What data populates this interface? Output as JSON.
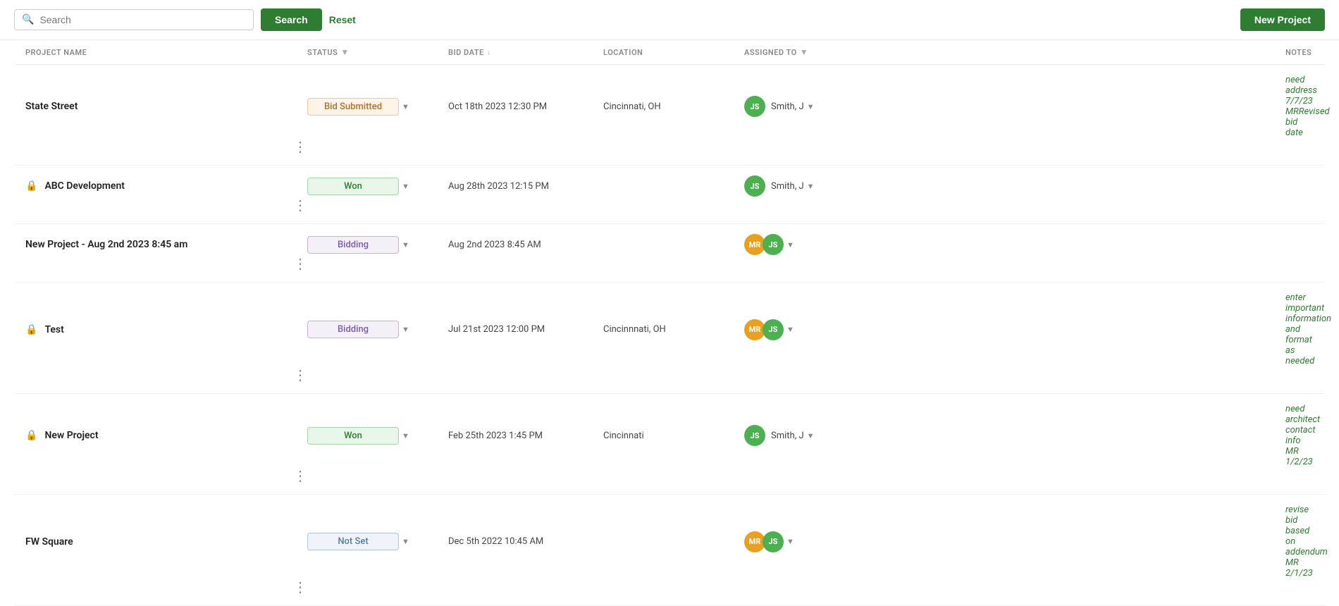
{
  "topbar": {
    "search_placeholder": "Search",
    "search_button": "Search",
    "reset_button": "Reset",
    "new_project_button": "New Project"
  },
  "table": {
    "headers": {
      "project_name": "PROJECT NAME",
      "status": "STATUS",
      "bid_date": "BID DATE",
      "location": "LOCATION",
      "assigned_to": "ASSIGNED TO",
      "notes": "NOTES"
    },
    "rows": [
      {
        "id": 1,
        "name": "State Street",
        "locked": false,
        "status": "Bid Submitted",
        "status_class": "status-bid-submitted",
        "bid_date": "Oct 18th 2023 12:30 PM",
        "location": "Cincinnati, OH",
        "assignees": [
          {
            "initials": "JS",
            "class": "avatar-js"
          }
        ],
        "assigned_name": "Smith, J",
        "notes": "need address 7/7/23 MRRevised bid date"
      },
      {
        "id": 2,
        "name": "ABC Development",
        "locked": true,
        "status": "Won",
        "status_class": "status-won",
        "bid_date": "Aug 28th 2023 12:15 PM",
        "location": "",
        "assignees": [
          {
            "initials": "JS",
            "class": "avatar-js"
          }
        ],
        "assigned_name": "Smith, J",
        "notes": ""
      },
      {
        "id": 3,
        "name": "New Project - Aug 2nd 2023 8:45 am",
        "locked": false,
        "status": "Bidding",
        "status_class": "status-bidding",
        "bid_date": "Aug 2nd 2023 8:45 AM",
        "location": "",
        "assignees": [
          {
            "initials": "MR",
            "class": "avatar-mr"
          },
          {
            "initials": "JS",
            "class": "avatar-js"
          }
        ],
        "assigned_name": "",
        "notes": ""
      },
      {
        "id": 4,
        "name": "Test",
        "locked": true,
        "status": "Bidding",
        "status_class": "status-bidding",
        "bid_date": "Jul 21st 2023 12:00 PM",
        "location": "Cincinnnati, OH",
        "assignees": [
          {
            "initials": "MR",
            "class": "avatar-mr"
          },
          {
            "initials": "JS",
            "class": "avatar-js"
          }
        ],
        "assigned_name": "",
        "notes": "enter important information and format as needed"
      },
      {
        "id": 5,
        "name": "New Project",
        "locked": true,
        "status": "Won",
        "status_class": "status-won",
        "bid_date": "Feb 25th 2023 1:45 PM",
        "location": "Cincinnati",
        "assignees": [
          {
            "initials": "JS",
            "class": "avatar-js"
          }
        ],
        "assigned_name": "Smith, J",
        "notes": "need architect contact info MR 1/2/23"
      },
      {
        "id": 6,
        "name": "FW Square",
        "locked": false,
        "status": "Not Set",
        "status_class": "status-not-set",
        "bid_date": "Dec 5th 2022 10:45 AM",
        "location": "",
        "assignees": [
          {
            "initials": "MR",
            "class": "avatar-mr"
          },
          {
            "initials": "JS",
            "class": "avatar-js"
          }
        ],
        "assigned_name": "",
        "notes": "revise bid based on addendum MR 2/1/23"
      }
    ]
  }
}
